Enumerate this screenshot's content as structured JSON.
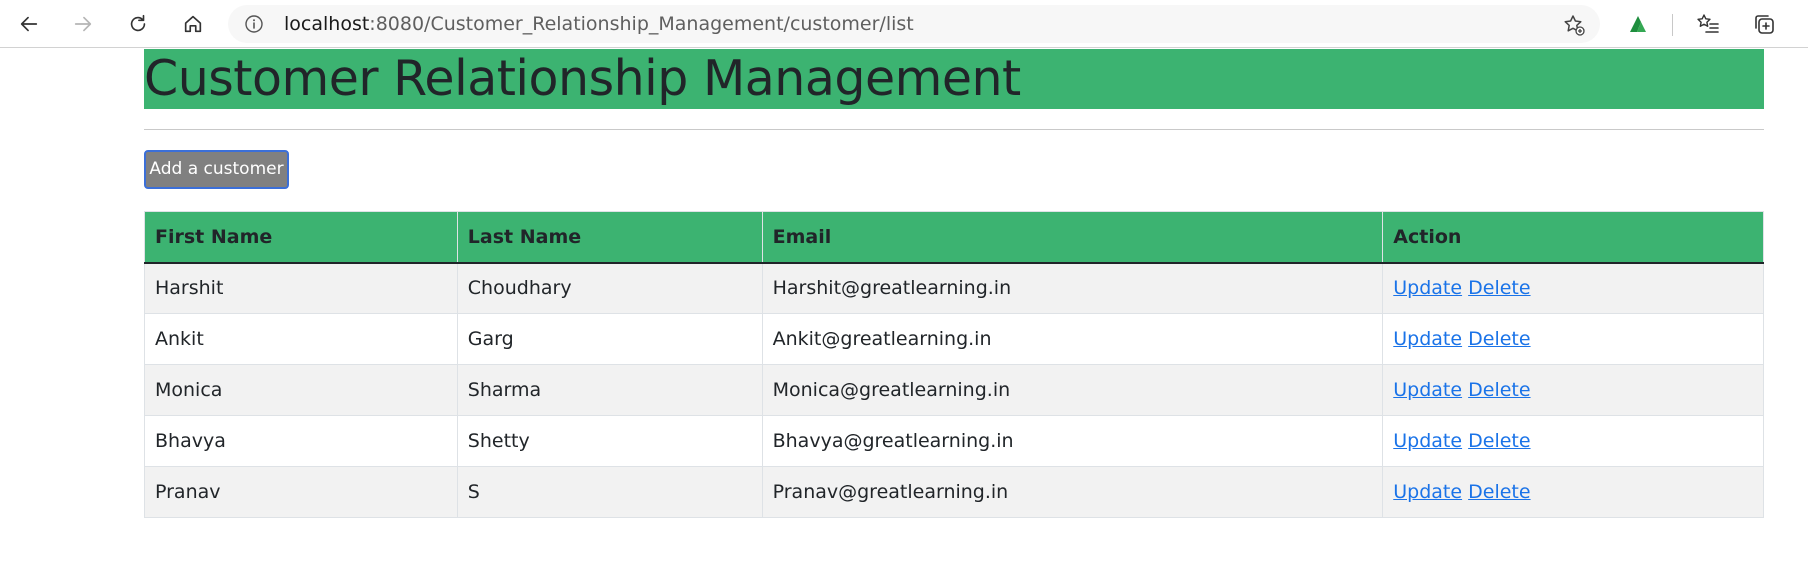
{
  "browser": {
    "url_host": "localhost",
    "url_rest": ":8080/Customer_Relationship_Management/customer/list",
    "icons": [
      "back-icon",
      "forward-icon",
      "refresh-icon",
      "home-icon",
      "info-icon",
      "favorite-add-icon",
      "extension-icon",
      "favorites-icon",
      "collections-icon"
    ]
  },
  "page": {
    "title": "Customer Relationship Management",
    "add_button": "Add a customer",
    "accent_color": "#3cb371"
  },
  "table": {
    "headers": [
      "First Name",
      "Last Name",
      "Email",
      "Action"
    ],
    "rows": [
      {
        "first": "Harshit",
        "last": "Choudhary",
        "email": "Harshit@greatlearning.in",
        "update": "Update",
        "delete": "Delete"
      },
      {
        "first": "Ankit",
        "last": "Garg",
        "email": "Ankit@greatlearning.in",
        "update": "Update",
        "delete": "Delete"
      },
      {
        "first": "Monica",
        "last": "Sharma",
        "email": "Monica@greatlearning.in",
        "update": "Update",
        "delete": "Delete"
      },
      {
        "first": "Bhavya",
        "last": "Shetty",
        "email": "Bhavya@greatlearning.in",
        "update": "Update",
        "delete": "Delete"
      },
      {
        "first": "Pranav",
        "last": "S",
        "email": "Pranav@greatlearning.in",
        "update": "Update",
        "delete": "Delete"
      }
    ]
  }
}
